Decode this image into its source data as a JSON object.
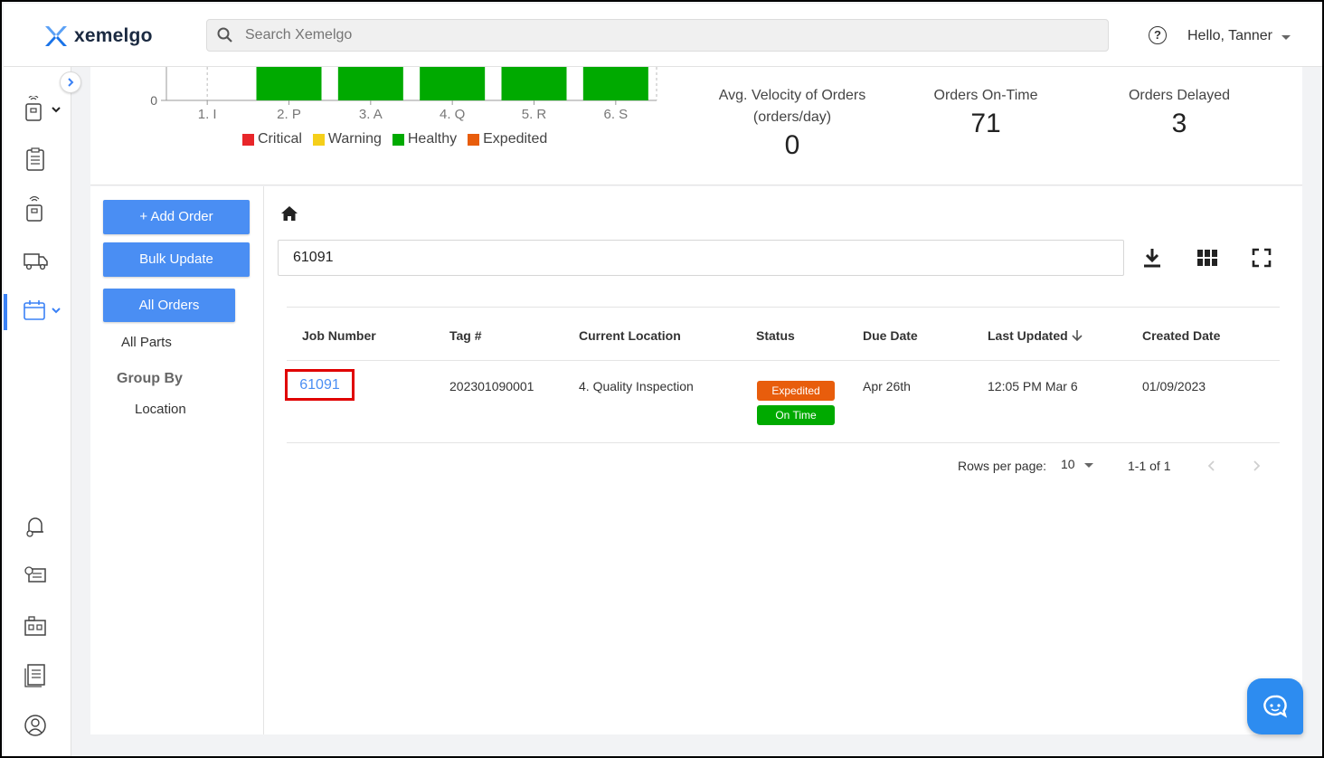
{
  "header": {
    "logo_text": "xemelgo",
    "search_placeholder": "Search Xemelgo",
    "help_glyph": "?",
    "user_greeting": "Hello, Tanner"
  },
  "chart_data": {
    "type": "bar",
    "categories": [
      "1. I",
      "2. P",
      "3. A",
      "4. Q",
      "5. R",
      "6. S"
    ],
    "y_tick_visible": "0",
    "series": [
      {
        "name": "Healthy",
        "values": [
          0,
          null,
          null,
          null,
          null,
          null
        ]
      }
    ],
    "bar_color": "#00aa00",
    "legend": [
      {
        "label": "Critical",
        "color": "#e8262a"
      },
      {
        "label": "Warning",
        "color": "#f5cf1a"
      },
      {
        "label": "Healthy",
        "color": "#00aa00"
      },
      {
        "label": "Expedited",
        "color": "#e85d0c"
      }
    ],
    "note_visible_range": "bar tops cropped above view"
  },
  "stats": [
    {
      "label_line1": "Avg. Velocity of Orders",
      "label_line2": "(orders/day)",
      "value": "0"
    },
    {
      "label_line1": "Orders On-Time",
      "label_line2": "",
      "value": "71"
    },
    {
      "label_line1": "Orders Delayed",
      "label_line2": "",
      "value": "3"
    }
  ],
  "sidebar": {
    "add_order": "+ Add Order",
    "bulk_update": "Bulk Update",
    "all_orders": "All Orders",
    "all_parts": "All Parts",
    "group_by": "Group By",
    "location": "Location"
  },
  "filter": {
    "value": "61091"
  },
  "table": {
    "columns": [
      "Job Number",
      "Tag #",
      "Current Location",
      "Status",
      "Due Date",
      "Last Updated",
      "Created Date"
    ],
    "rows": [
      {
        "job_number": "61091",
        "tag": "202301090001",
        "location": "4. Quality Inspection",
        "status_1": "Expedited",
        "status_2": "On Time",
        "due_date": "Apr 26th",
        "last_updated": "12:05 PM Mar 6",
        "created_date": "01/09/2023"
      }
    ]
  },
  "pagination": {
    "rows_per_page_label": "Rows per page:",
    "rows_per_page_value": "10",
    "range": "1-1 of 1"
  },
  "colors": {
    "accent": "#4a8ef3",
    "expedited": "#e85d0c",
    "on_time": "#00aa00",
    "highlight": "#e00000"
  }
}
